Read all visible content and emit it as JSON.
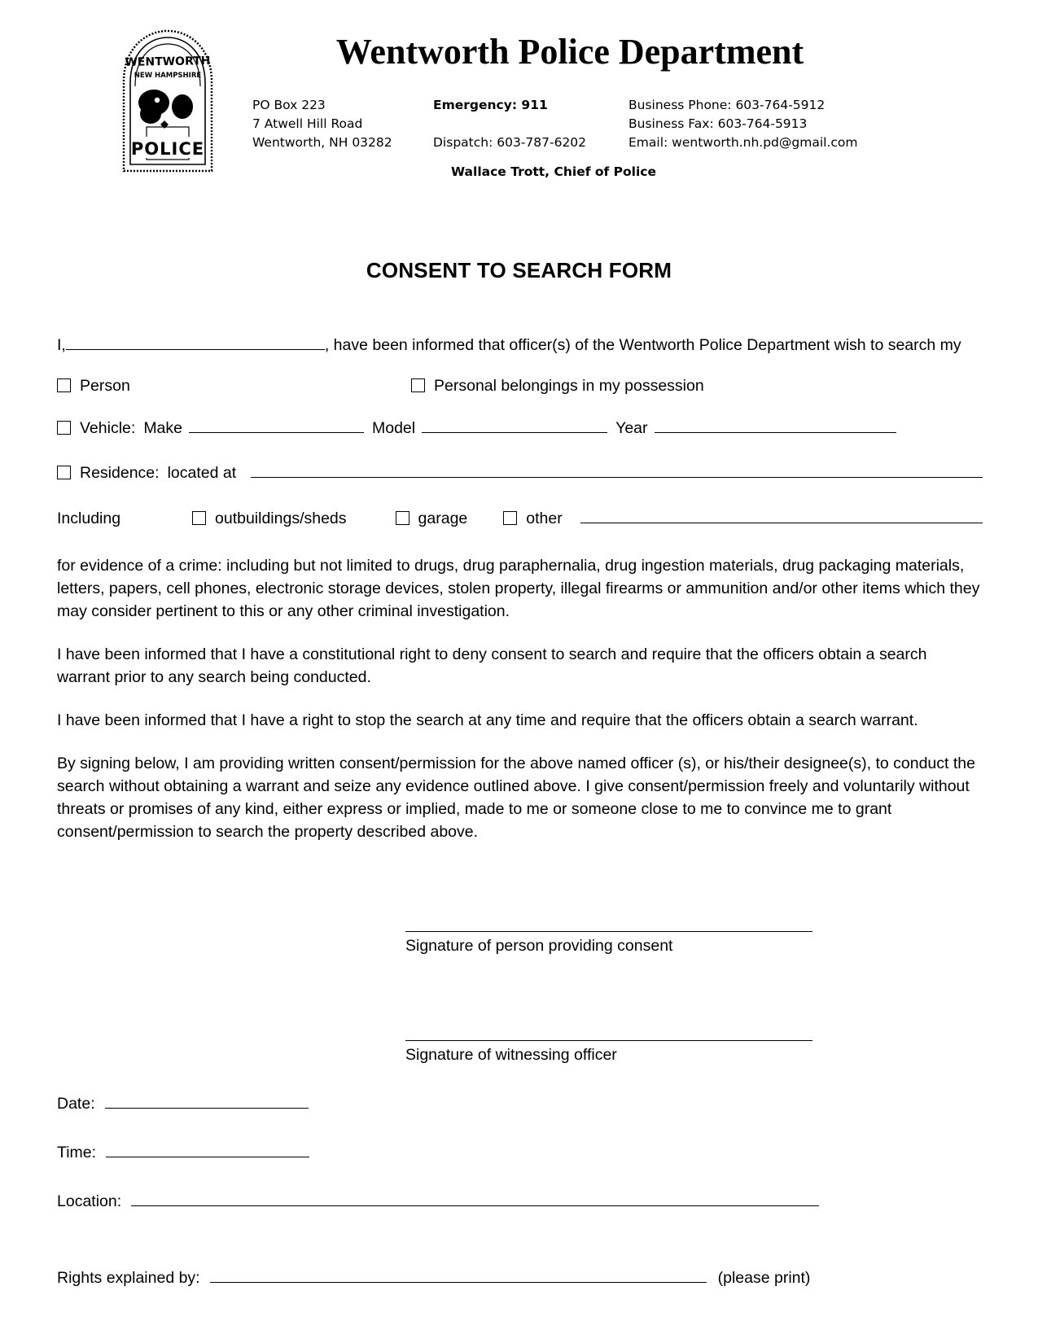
{
  "letterhead": {
    "badge_alt": "police-badge",
    "badge_top_text": "WENTWORTH",
    "badge_sub_text": "NEW HAMPSHIRE",
    "badge_bottom_text": "POLICE",
    "department_name": "Wentworth Police Department",
    "address_line1": "PO Box 223",
    "address_line2": "7 Atwell Hill Road",
    "address_line3": "Wentworth, NH 03282",
    "emergency": "Emergency: 911",
    "dispatch": "Dispatch: 603-787-6202",
    "business_phone": "Business Phone: 603-764-5912",
    "business_fax": "Business Fax: 603-764-5913",
    "email": "Email: wentworth.nh.pd@gmail.com",
    "chief": "Wallace Trott, Chief of Police"
  },
  "form": {
    "title": "CONSENT TO SEARCH FORM",
    "lead_prefix": "I,",
    "lead_suffix": ", have been informed that officer(s) of the Wentworth Police Department wish to search my",
    "options": {
      "person": "Person",
      "personal_belongings": "Personal belongings in my possession",
      "vehicle": "Vehicle:",
      "make": "Make",
      "model": "Model",
      "year": "Year",
      "residence": "Residence:",
      "located_at": "located at",
      "including": "Including",
      "outbuildings": "outbuildings/sheds",
      "garage": "garage",
      "other": "other"
    },
    "paragraphs": [
      "for evidence of a crime: including but not limited to drugs, drug paraphernalia, drug ingestion materials, drug packaging materials, letters, papers, cell phones, electronic storage devices, stolen property, illegal firearms or ammunition and/or other items  which they may consider pertinent to this or any other criminal investigation.",
      "I have been informed that I have a constitutional right to deny consent to search and require that the officers obtain a search warrant prior to any search being conducted.",
      "I have been informed that I have a right to stop the search at any time and require that the officers obtain a search warrant.",
      "By signing below, I am providing written consent/permission for the above named officer (s), or his/their designee(s), to conduct the search without obtaining a warrant and seize any evidence outlined above.  I give consent/permission freely and voluntarily without threats or promises of any kind, either express or implied, made to me or someone close to me to convince me to grant consent/permission to search the property described above."
    ],
    "signatures": {
      "consent_caption": "Signature of person providing consent",
      "officer_caption": "Signature of witnessing officer"
    },
    "fields": {
      "date": "Date:",
      "time": "Time:",
      "location": "Location:",
      "rights_explained_by": "Rights explained by:",
      "please_print": "(please print)"
    }
  }
}
